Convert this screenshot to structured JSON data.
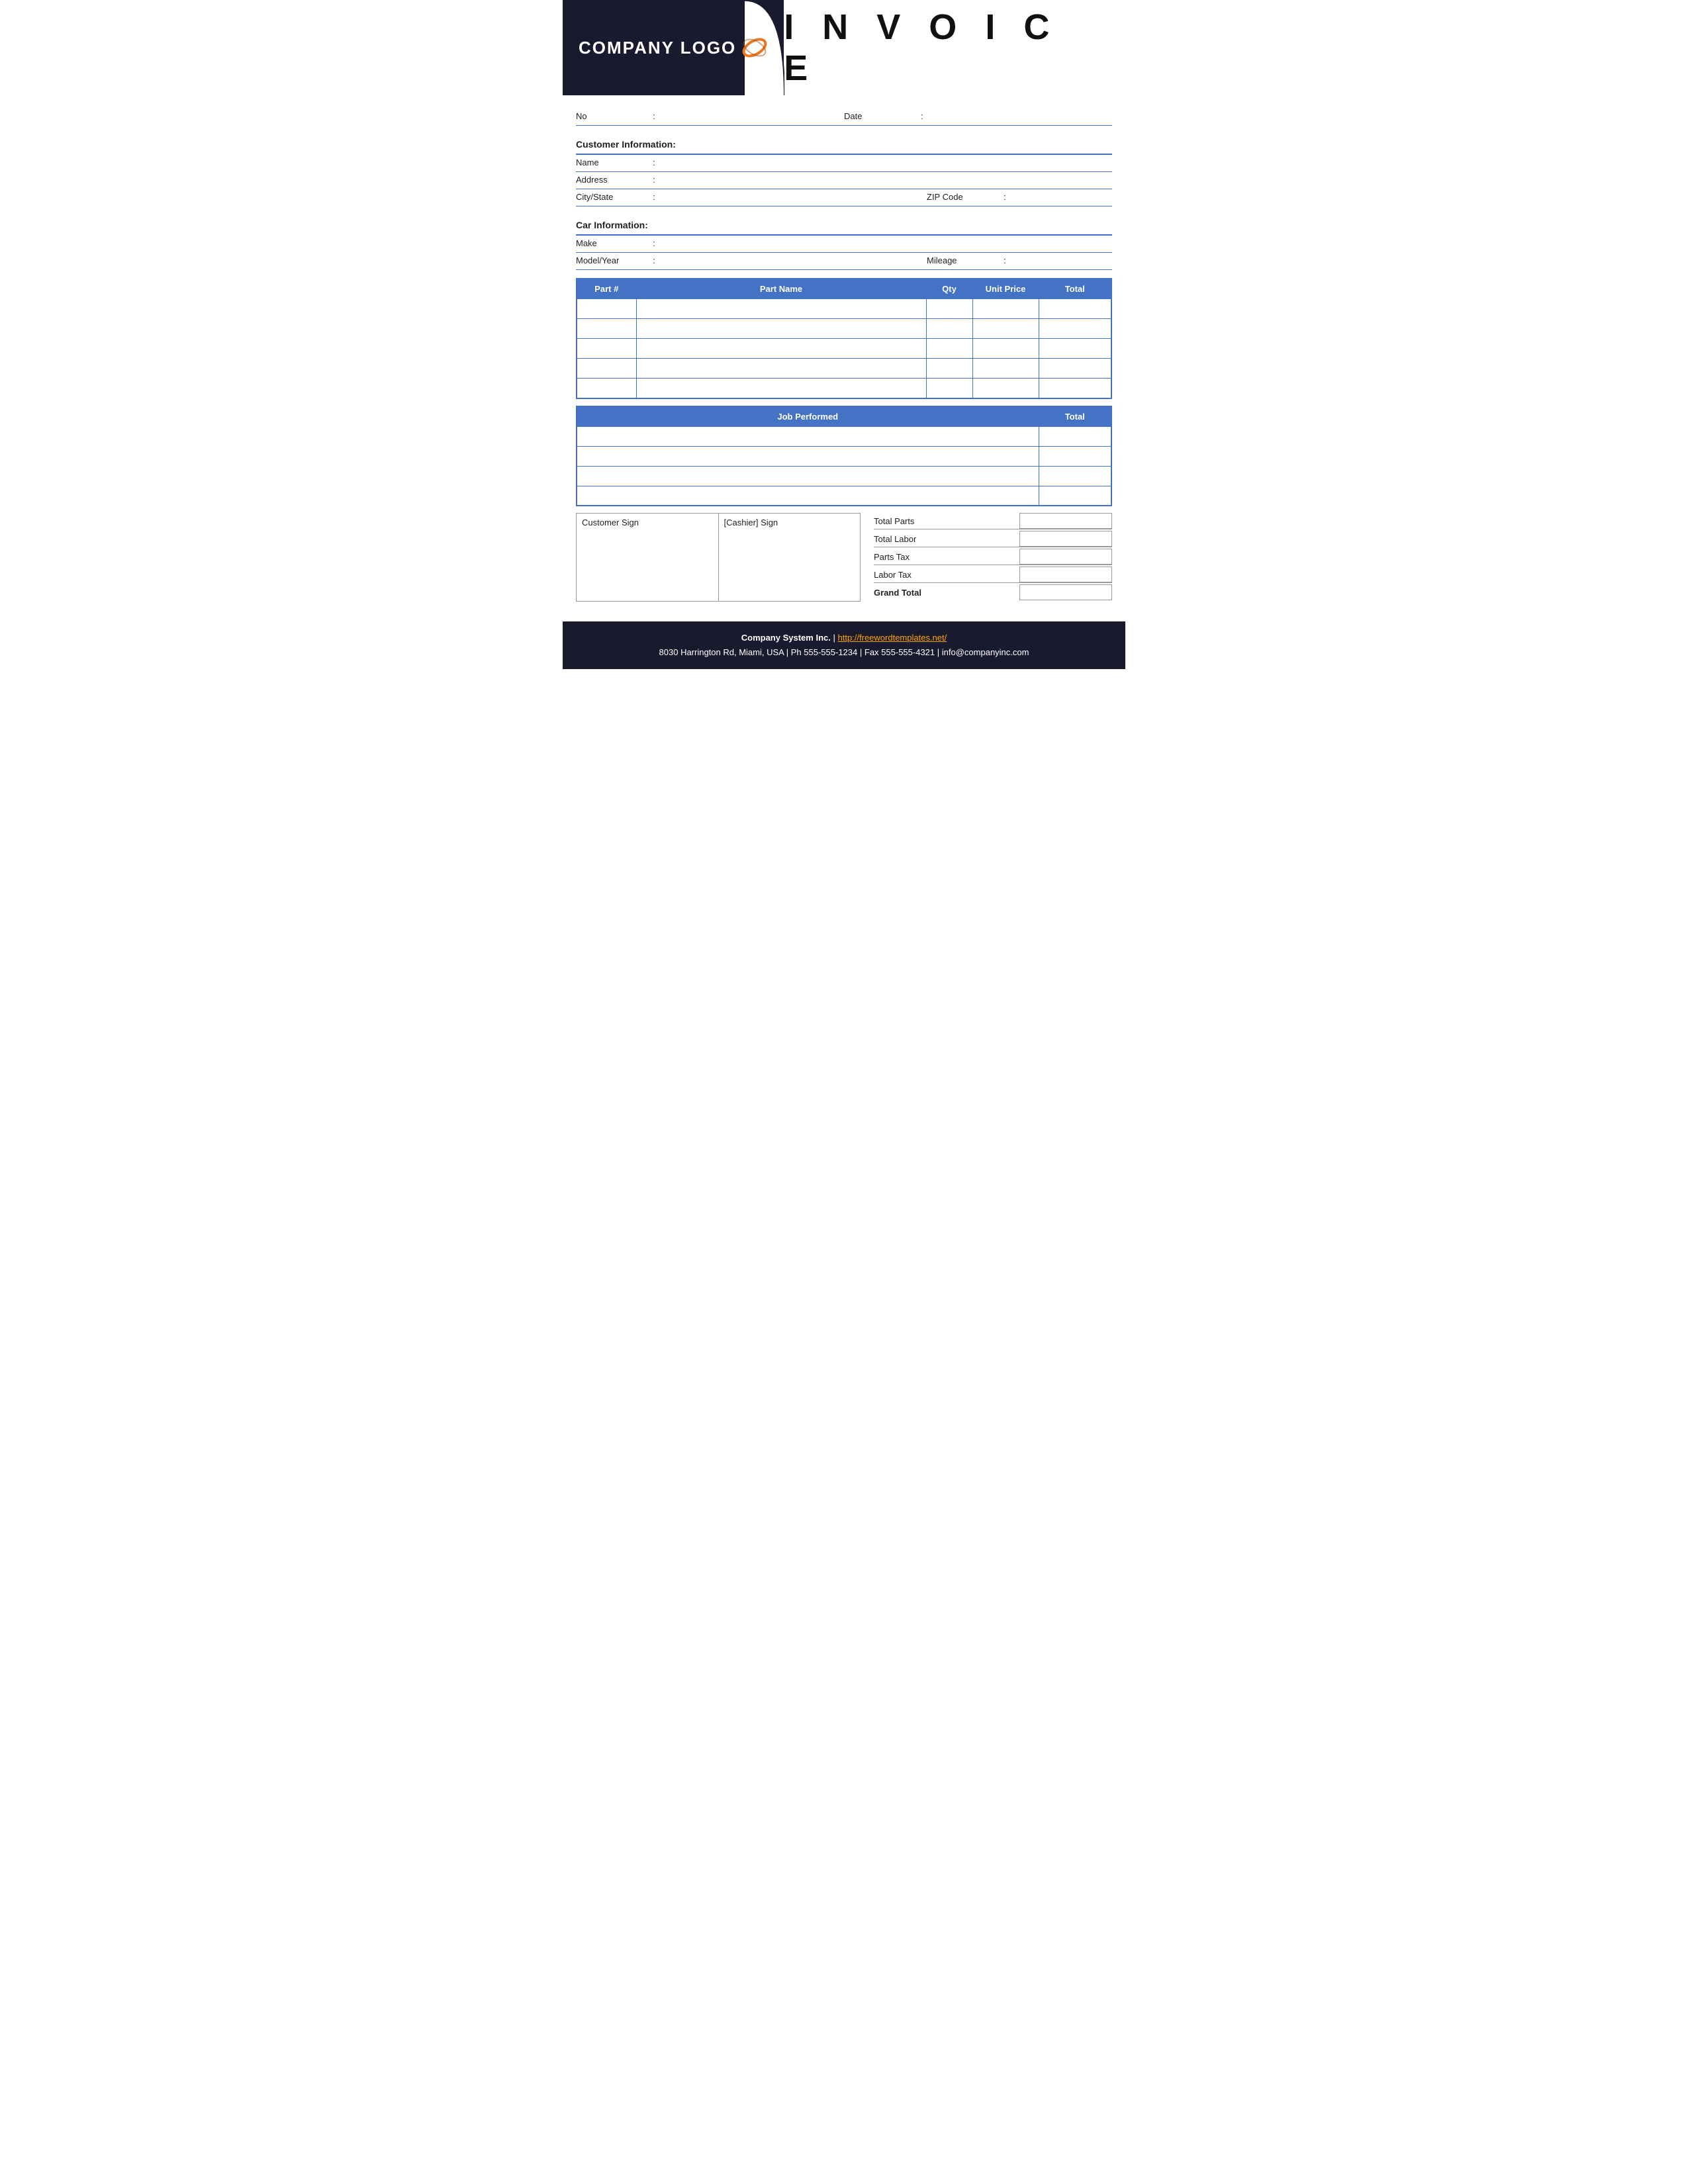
{
  "header": {
    "logo_text": "COMPANY LOGO",
    "title": "I N V O I C E"
  },
  "invoice_fields": {
    "no_label": "No",
    "no_colon": ":",
    "date_label": "Date",
    "date_colon": ":"
  },
  "customer_info": {
    "section_title": "Customer Information:",
    "name_label": "Name",
    "name_colon": ":",
    "address_label": "Address",
    "address_colon": ":",
    "city_state_label": "City/State",
    "city_state_colon": ":",
    "zip_label": "ZIP Code",
    "zip_colon": ":"
  },
  "car_info": {
    "section_title": "Car Information:",
    "make_label": "Make",
    "make_colon": ":",
    "model_label": "Model/Year",
    "model_colon": ":",
    "mileage_label": "Mileage",
    "mileage_colon": ":"
  },
  "parts_table": {
    "col_part": "Part #",
    "col_name": "Part Name",
    "col_qty": "Qty",
    "col_price": "Unit Price",
    "col_total": "Total",
    "rows": 5
  },
  "job_table": {
    "col_job": "Job Performed",
    "col_total": "Total",
    "rows": 4
  },
  "signatures": {
    "customer_sign": "Customer Sign",
    "cashier_sign": "[Cashier] Sign"
  },
  "totals": {
    "total_parts_label": "Total Parts",
    "total_labor_label": "Total Labor",
    "parts_tax_label": "Parts Tax",
    "labor_tax_label": "Labor Tax",
    "grand_total_label": "Grand Total"
  },
  "footer": {
    "company_name": "Company System Inc.",
    "separator": "|",
    "website": "http://freewordtemplates.net/",
    "address": "8030 Harrington Rd, Miami, USA",
    "ph_label": "Ph",
    "phone": "555-555-1234",
    "fax_label": "Fax",
    "fax": "555-555-4321",
    "email": "info@companyinc.com"
  }
}
